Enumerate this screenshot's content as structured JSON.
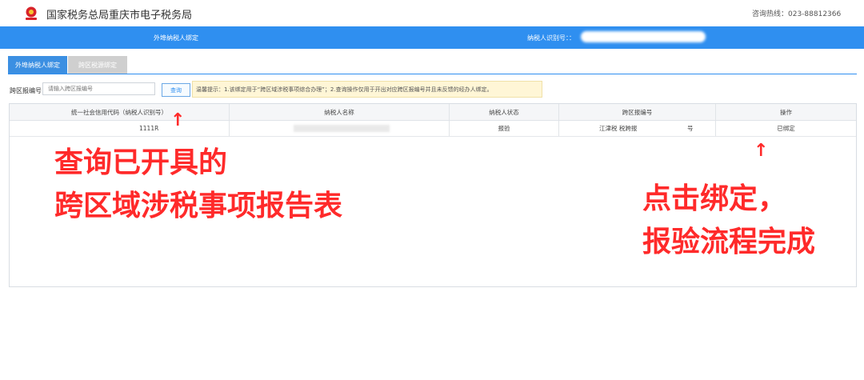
{
  "header": {
    "title": "国家税务总局重庆市电子税务局",
    "hotline": "咨询热线：023-88812366",
    "emblem_icon": "tax-emblem-icon"
  },
  "bar": {
    "title": "外埠纳税人绑定",
    "taxpayer_id_label": "纳税人识别号：："
  },
  "tabs": [
    {
      "label": "外埠纳税人绑定",
      "active": true
    },
    {
      "label": "跨区税源绑定",
      "active": false
    }
  ],
  "search": {
    "label": "跨区报编号",
    "placeholder": "请输入跨区报编号",
    "button_label": "查询"
  },
  "notice": "温馨提示：1.该绑定用于“跨区域涉税事项综合办理”；2.查询操作仅用于开出对应跨区报编号并且未反馈的经办人绑定。",
  "table": {
    "columns": [
      "统一社会信用代码（纳税人识别号）",
      "纳税人名称",
      "纳税人状态",
      "跨区报编号",
      "操作"
    ],
    "rows": [
      {
        "credit_code": "1111R",
        "name": "",
        "status": "报验",
        "report_no": "江津税 税跨报",
        "report_no_suffix": "号",
        "action": "已绑定"
      }
    ]
  },
  "annotations": {
    "left_line1": "查询已开具的",
    "left_line2": "跨区域涉税事项报告表",
    "right_line1": "点击绑定，",
    "right_line2": "报验流程完成",
    "arrow": "↑"
  },
  "colors": {
    "primary": "#2f8ff0",
    "annotation": "#ff2a2a",
    "notice_bg": "#fff6d6",
    "tab_inactive": "#cfcfcf"
  }
}
